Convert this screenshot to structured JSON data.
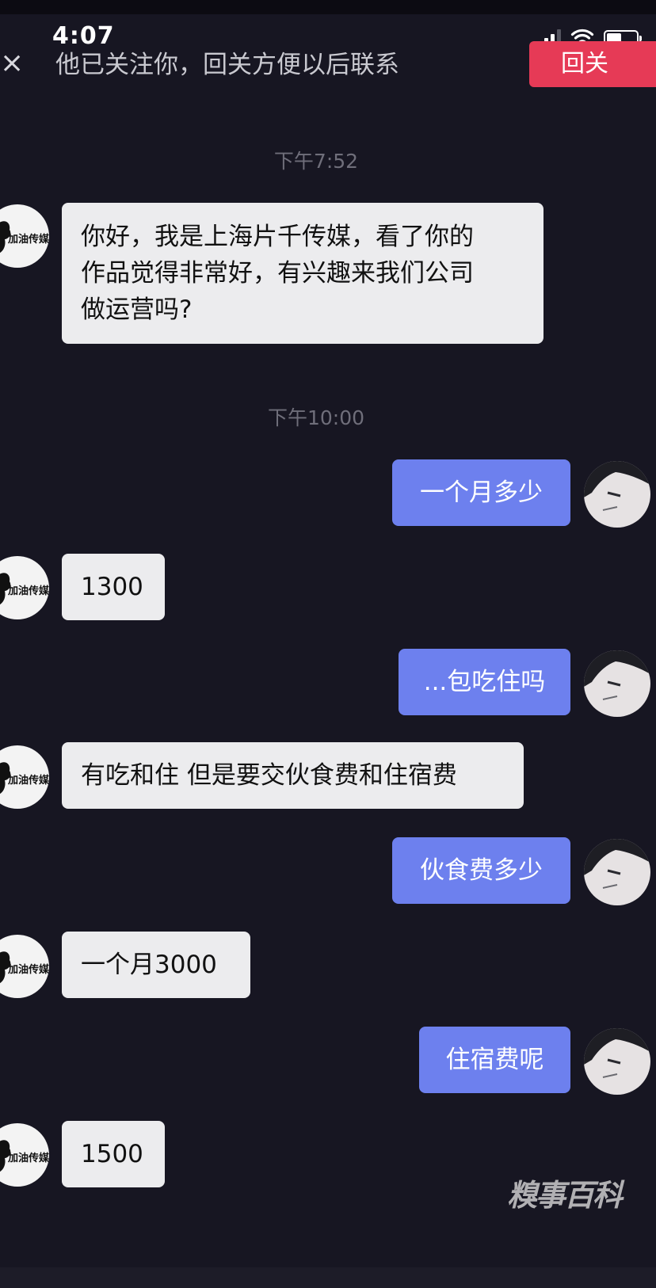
{
  "status_bar": {
    "time": "4:07"
  },
  "header": {
    "close_symbol": "×",
    "banner_text": "他已关注你，回关方便以后联系",
    "follow_back_label": "回关"
  },
  "messages": [
    {
      "type": "timestamp",
      "text": "下午7:52"
    },
    {
      "type": "incoming",
      "lines": [
        "你好，我是上海片千传媒，看了你的",
        "作品觉得非常好，有兴趣来我们公司",
        "做运营吗?"
      ]
    },
    {
      "type": "timestamp",
      "text": "下午10:00"
    },
    {
      "type": "outgoing",
      "text": "一个月多少"
    },
    {
      "type": "incoming",
      "text": "1300"
    },
    {
      "type": "outgoing",
      "text": "...包吃住吗"
    },
    {
      "type": "incoming",
      "text": "有吃和住 但是要交伙食费和住宿费"
    },
    {
      "type": "outgoing",
      "text": "伙食费多少"
    },
    {
      "type": "incoming",
      "text": "一个月3000"
    },
    {
      "type": "outgoing",
      "text": "住宿费呢"
    },
    {
      "type": "incoming",
      "text": "1500"
    }
  ],
  "contact_avatar_text": "加油传媒",
  "watermark_text": "糗事百科",
  "colors": {
    "background": "#171622",
    "incoming_bubble": "#ececee",
    "outgoing_bubble": "#6d80ee",
    "follow_back_button": "#e63a56"
  },
  "icons": [
    "close-icon",
    "signal-icon",
    "wifi-icon",
    "battery-icon"
  ]
}
